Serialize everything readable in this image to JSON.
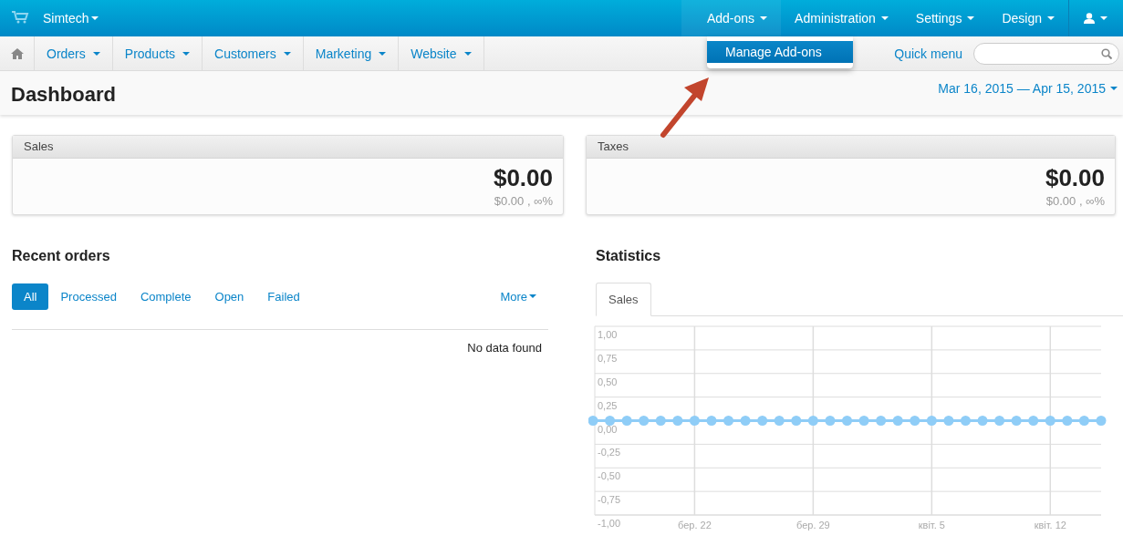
{
  "top_bar": {
    "store": "Simtech",
    "menus": [
      {
        "label": "Add-ons",
        "selected": true
      },
      {
        "label": "Administration",
        "selected": false
      },
      {
        "label": "Settings",
        "selected": false
      },
      {
        "label": "Design",
        "selected": false
      }
    ],
    "dropdown": [
      {
        "label": "Manage Add-ons",
        "selected": true
      }
    ]
  },
  "nav": {
    "items": [
      "Orders",
      "Products",
      "Customers",
      "Marketing",
      "Website"
    ],
    "quick_menu": "Quick menu"
  },
  "page": {
    "title": "Dashboard",
    "date_range": "Mar 16, 2015 — Apr 15, 2015"
  },
  "cards": [
    {
      "title": "Sales",
      "value": "$0.00",
      "detail": "$0.00 , ∞%"
    },
    {
      "title": "Taxes",
      "value": "$0.00",
      "detail": "$0.00 , ∞%"
    }
  ],
  "recent_orders": {
    "title": "Recent orders",
    "tabs": [
      {
        "label": "All",
        "selected": true
      },
      {
        "label": "Processed",
        "selected": false
      },
      {
        "label": "Complete",
        "selected": false
      },
      {
        "label": "Open",
        "selected": false
      },
      {
        "label": "Failed",
        "selected": false
      }
    ],
    "more": "More",
    "empty": "No data found"
  },
  "statistics": {
    "title": "Statistics",
    "tabs": [
      {
        "label": "Sales",
        "selected": true
      }
    ],
    "chart_data": {
      "type": "line",
      "categories": [
        null,
        null,
        null,
        null,
        null,
        null,
        "бер. 22",
        null,
        null,
        null,
        null,
        null,
        null,
        "бер. 29",
        null,
        null,
        null,
        null,
        null,
        null,
        "квіт. 5",
        null,
        null,
        null,
        null,
        null,
        null,
        "квіт. 12",
        null,
        null,
        null
      ],
      "series": [
        {
          "color": "#8fcdf7",
          "marker": true,
          "values": [
            0,
            0,
            0,
            0,
            0,
            0,
            0,
            0,
            0,
            0,
            0,
            0,
            0,
            0,
            0,
            0,
            0,
            0,
            0,
            0,
            0,
            0,
            0,
            0,
            0,
            0,
            0,
            0,
            0,
            0,
            0
          ]
        }
      ],
      "ylim": [
        -1,
        1
      ],
      "grid": true,
      "yticks": [
        {
          "value": 1,
          "label": "1,00"
        },
        {
          "value": 0.75,
          "label": "0,75"
        },
        {
          "value": 0.5,
          "label": "0,50"
        },
        {
          "value": 0.25,
          "label": "0,25"
        },
        {
          "value": 0,
          "label": "0,00"
        },
        {
          "value": -0.25,
          "label": "-0,25"
        },
        {
          "value": -0.5,
          "label": "-0,50"
        },
        {
          "value": -0.75,
          "label": "-0,75"
        },
        {
          "value": -1,
          "label": "-1,00"
        }
      ]
    }
  }
}
